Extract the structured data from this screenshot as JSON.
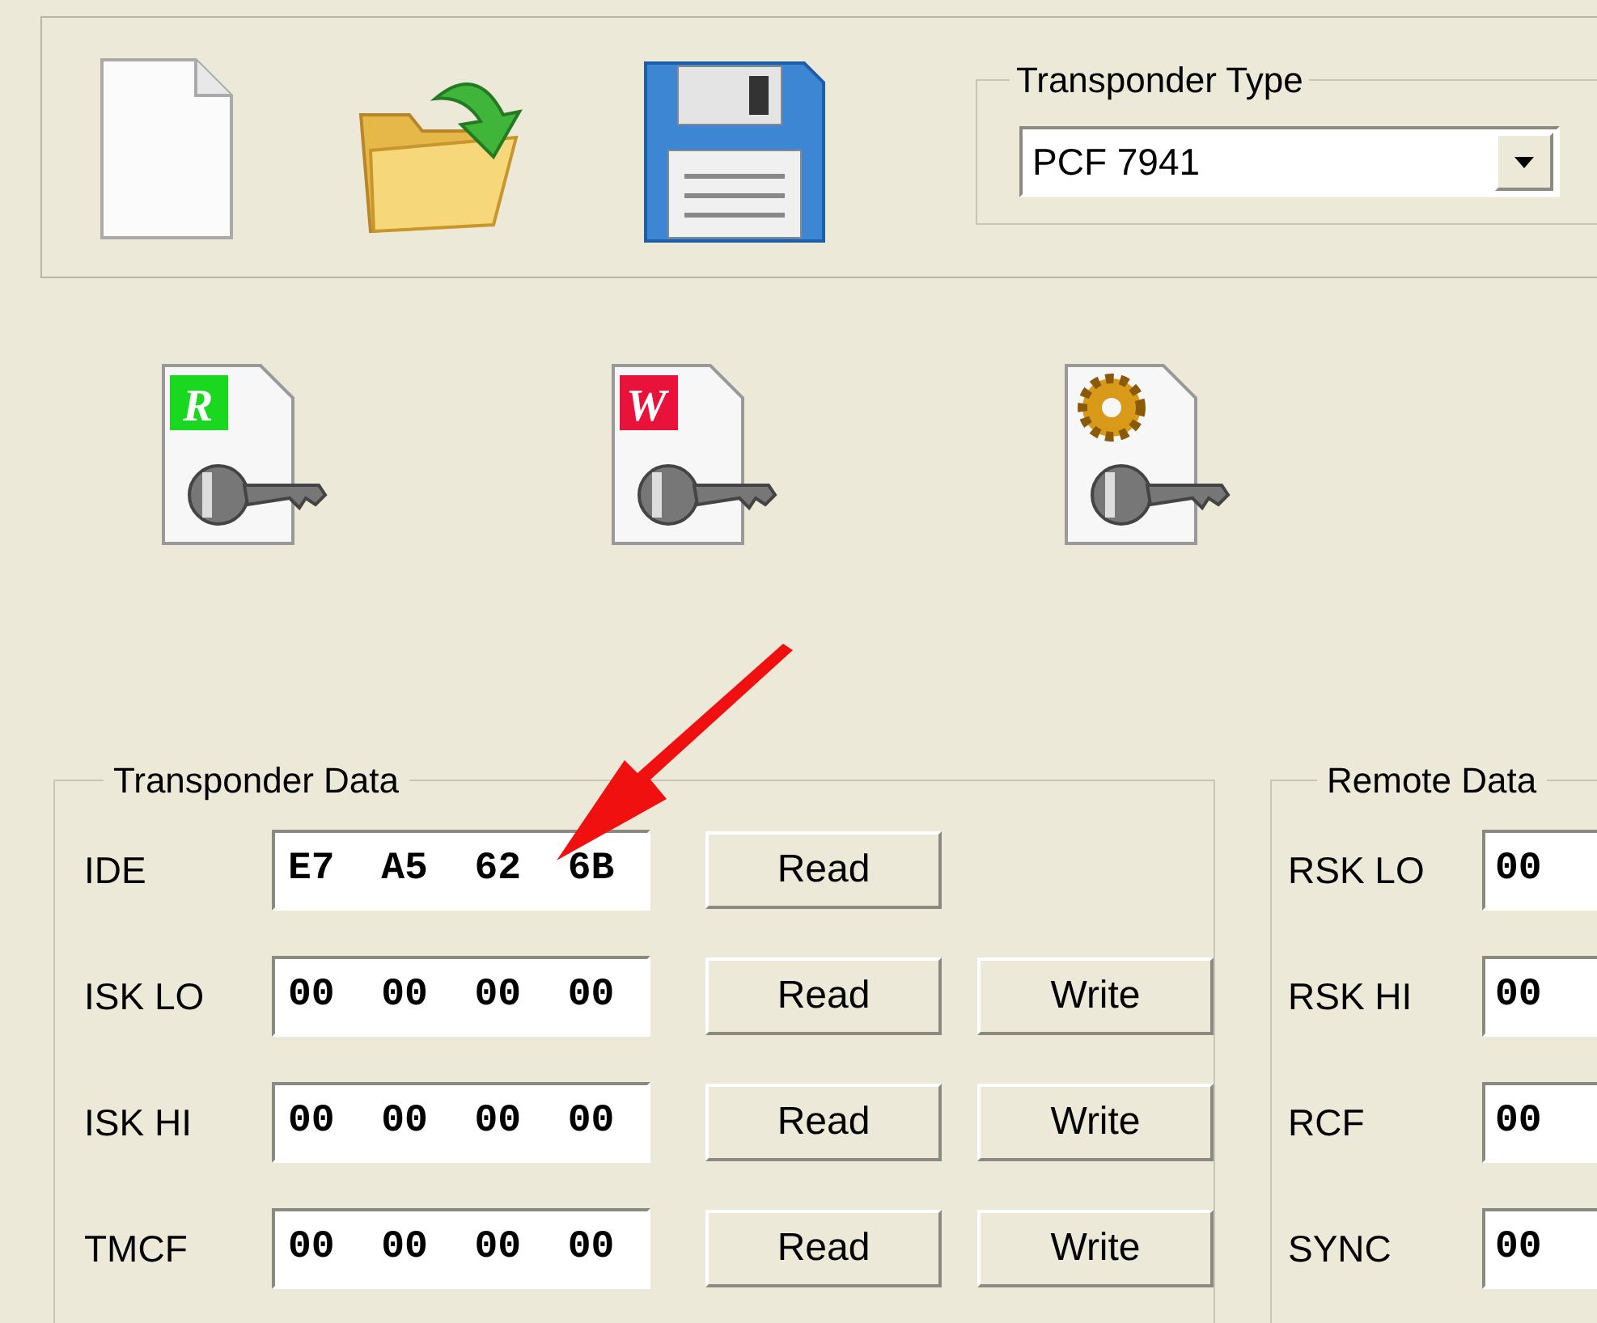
{
  "toolbar": {
    "transponder_type": {
      "label": "Transponder Type",
      "value": "PCF 7941"
    }
  },
  "key_icons": {
    "read_badge": "R",
    "write_badge": "W"
  },
  "transponder_data": {
    "title": "Transponder Data",
    "rows": [
      {
        "label": "IDE",
        "value": "E7  A5  62  6B",
        "buttons": [
          "Read"
        ]
      },
      {
        "label": "ISK LO",
        "value": "00  00  00  00",
        "buttons": [
          "Read",
          "Write"
        ]
      },
      {
        "label": "ISK HI",
        "value": "00  00  00  00",
        "buttons": [
          "Read",
          "Write"
        ]
      },
      {
        "label": "TMCF",
        "value": "00  00  00  00",
        "buttons": [
          "Read",
          "Write"
        ]
      }
    ]
  },
  "remote_data": {
    "title": "Remote Data",
    "rows": [
      {
        "label": "RSK LO",
        "value": "00"
      },
      {
        "label": "RSK HI",
        "value": "00"
      },
      {
        "label": "RCF",
        "value": "00"
      },
      {
        "label": "SYNC",
        "value": "00"
      }
    ]
  }
}
